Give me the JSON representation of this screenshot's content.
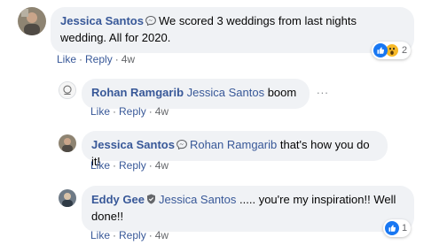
{
  "comments": [
    {
      "author": "Jessica Santos",
      "author_icon": "messenger-icon",
      "text": "We scored 3 weddings from last nights wedding. All for 2020.",
      "actions": {
        "like": "Like",
        "reply": "Reply",
        "time": "4w"
      },
      "reactions": {
        "icons": [
          "like-icon",
          "wow-icon"
        ],
        "count": "2"
      }
    },
    {
      "author": "Rohan Ramgarib",
      "mention": "Jessica Santos",
      "text": "boom",
      "actions": {
        "like": "Like",
        "reply": "Reply",
        "time": "4w"
      },
      "more": "..."
    },
    {
      "author": "Jessica Santos",
      "author_icon": "messenger-icon",
      "mention": "Rohan Ramgarib",
      "text": "that's how you do it!",
      "actions": {
        "like": "Like",
        "reply": "Reply",
        "time": "4w"
      }
    },
    {
      "author": "Eddy Gee",
      "author_icon": "verified-shield-icon",
      "mention": "Jessica Santos",
      "text_line1": "..... you're my inspiration!! Well",
      "text_line2": "done!!",
      "actions": {
        "like": "Like",
        "reply": "Reply",
        "time": "4w"
      },
      "reactions": {
        "icons": [
          "like-icon"
        ],
        "count": "1"
      }
    }
  ],
  "separator": "·",
  "colors": {
    "bubble": "#f0f2f5",
    "author": "#385898",
    "meta": "#65676b",
    "like_blue": "#1877f2",
    "wow_yellow": "#f7b928"
  }
}
